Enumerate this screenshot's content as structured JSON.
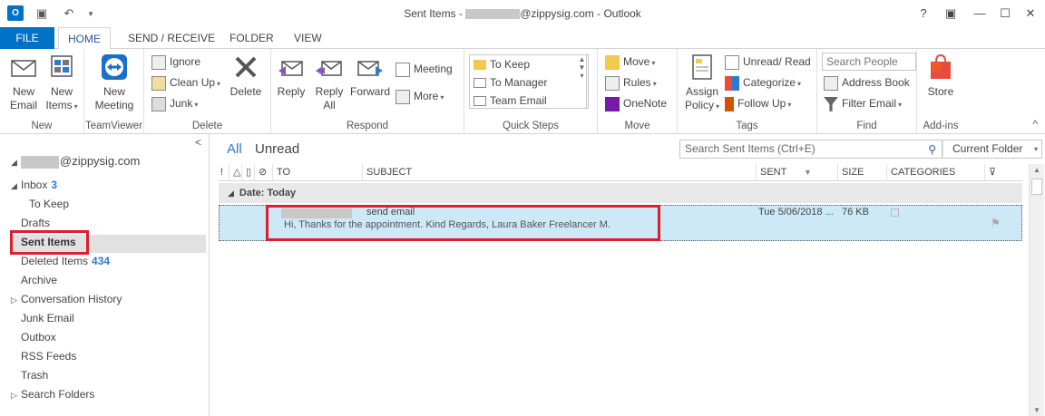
{
  "window": {
    "app_icon": "O",
    "title_prefix": "Sent Items - ",
    "title_suffix": "@zippysig.com - Outlook",
    "help": "?",
    "restore_ribbon": "▣",
    "minimize": "—",
    "maximize": "☐",
    "close": "✕"
  },
  "tabs": {
    "file": "FILE",
    "home": "HOME",
    "send_receive": "SEND / RECEIVE",
    "folder": "FOLDER",
    "view": "VIEW"
  },
  "ribbon": {
    "new_email": [
      "New",
      "Email"
    ],
    "new_items": [
      "New",
      "Items"
    ],
    "group_new": "New",
    "new_meeting": [
      "New",
      "Meeting"
    ],
    "group_teamviewer": "TeamViewer",
    "ignore": "Ignore",
    "clean_up": "Clean Up",
    "junk": "Junk",
    "delete": "Delete",
    "group_delete": "Delete",
    "reply": "Reply",
    "reply_all": [
      "Reply",
      "All"
    ],
    "forward": "Forward",
    "meeting": "Meeting",
    "more": "More",
    "group_respond": "Respond",
    "quick_steps": [
      "To Keep",
      "To Manager",
      "Team Email"
    ],
    "group_quick_steps": "Quick Steps",
    "move": "Move",
    "rules": "Rules",
    "onenote": "OneNote",
    "group_move": "Move",
    "assign_policy": [
      "Assign",
      "Policy"
    ],
    "unread_read": "Unread/ Read",
    "categorize": "Categorize",
    "follow_up": "Follow Up",
    "group_tags": "Tags",
    "search_people_placeholder": "Search People",
    "address_book": "Address Book",
    "filter_email": "Filter Email",
    "group_find": "Find",
    "store": "Store",
    "group_addins": "Add-ins",
    "collapse": "^"
  },
  "folders": {
    "collapse_pane": "<",
    "account_suffix": "@zippysig.com",
    "inbox": "Inbox",
    "inbox_count": "3",
    "to_keep": "To Keep",
    "drafts": "Drafts",
    "sent_items": "Sent Items",
    "deleted_items": "Deleted Items",
    "deleted_count": "434",
    "archive": "Archive",
    "conversation_history": "Conversation History",
    "junk_email": "Junk Email",
    "outbox": "Outbox",
    "rss_feeds": "RSS Feeds",
    "trash": "Trash",
    "search_folders": "Search Folders"
  },
  "list": {
    "filter_all": "All",
    "filter_unread": "Unread",
    "search_placeholder": "Search Sent Items (Ctrl+E)",
    "scope": "Current Folder",
    "columns": {
      "importance": "!",
      "to": "TO",
      "subject": "SUBJECT",
      "sent": "SENT",
      "size": "SIZE",
      "categories": "CATEGORIES"
    },
    "group_header": "Date: Today",
    "message": {
      "subject": "send email",
      "preview": "Hi,  Thanks for the appointment.  Kind Regards,  Laura Baker  Freelancer  M.",
      "sent": "Tue 5/06/2018 ...",
      "size": "76 KB"
    }
  },
  "colors": {
    "accent": "#0072c6",
    "highlight_red": "#d9202c",
    "selected_row": "#cde8f7",
    "link_blue": "#2b7bd1"
  }
}
